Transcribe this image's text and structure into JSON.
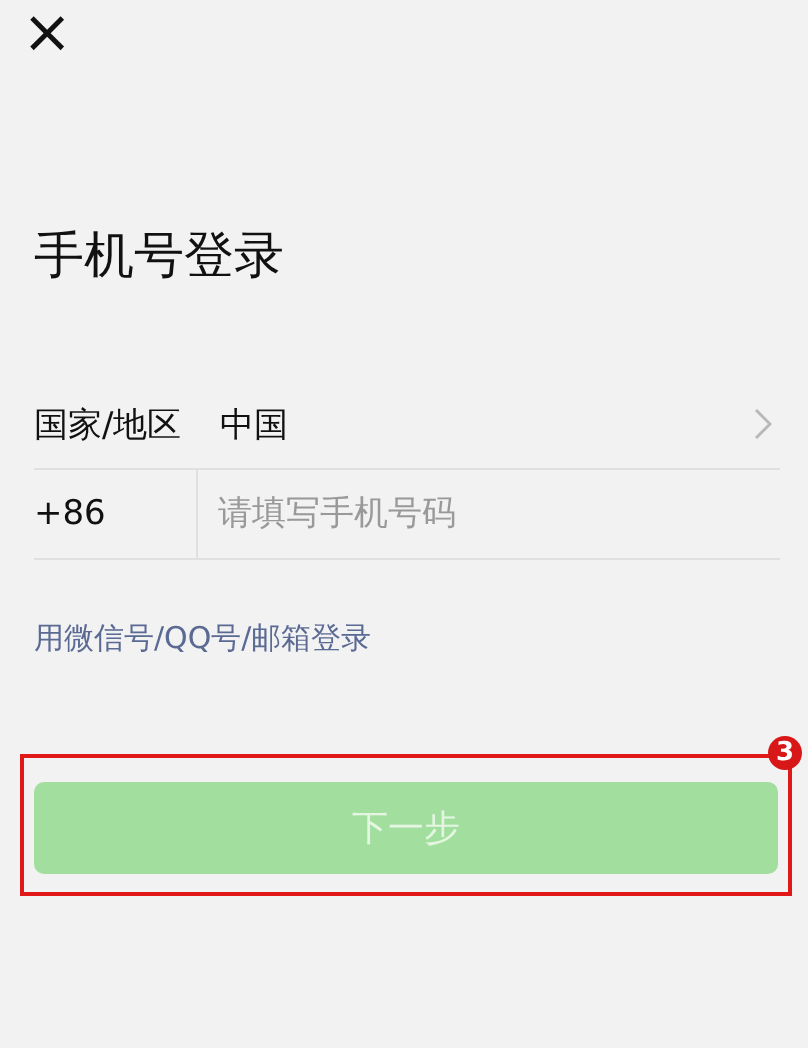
{
  "close_button": {
    "label": "×"
  },
  "title": "手机号登录",
  "country_row": {
    "label": "国家/地区",
    "value": "中国"
  },
  "phone_row": {
    "code": "+86",
    "placeholder": "请填写手机号码"
  },
  "alt_login_link": "用微信号/QQ号/邮箱登录",
  "next_button": {
    "label": "下一步",
    "disabled": true
  },
  "annotation": {
    "step": "3"
  }
}
